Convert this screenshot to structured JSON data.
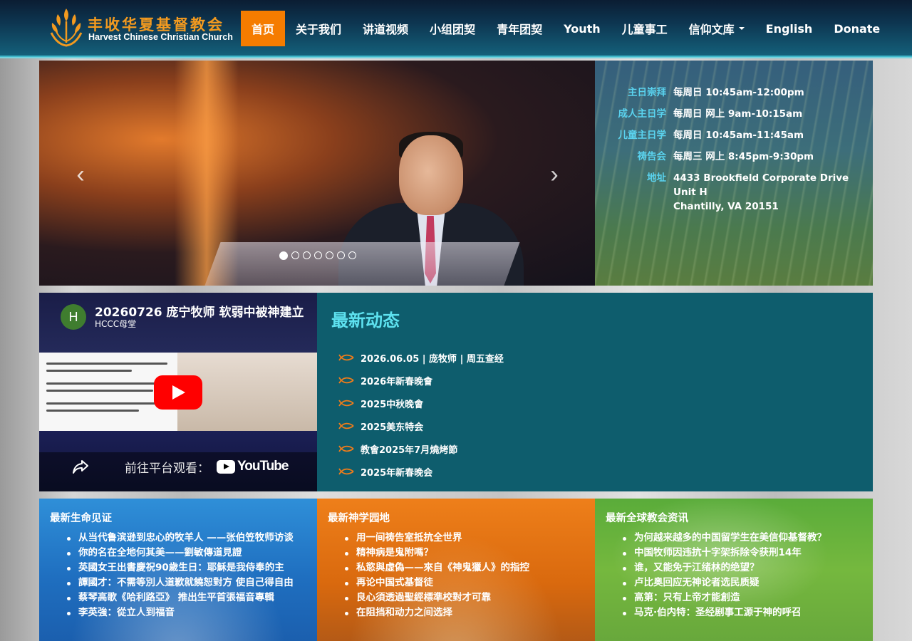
{
  "brand": {
    "name_cn": "丰收华夏基督教会",
    "name_en": "Harvest Chinese Christian Church",
    "accent_orange": "#f57c00",
    "nav_bg": "#0d3550"
  },
  "nav": {
    "items": [
      {
        "label": "首页",
        "active": true
      },
      {
        "label": "关于我们"
      },
      {
        "label": "讲道视频"
      },
      {
        "label": "小组团契"
      },
      {
        "label": "青年团契"
      },
      {
        "label": "Youth"
      },
      {
        "label": "儿童事工"
      },
      {
        "label": "信仰文库",
        "dropdown": true
      },
      {
        "label": "English"
      },
      {
        "label": "Donate"
      }
    ]
  },
  "carousel": {
    "prev_icon": "chevron-left-icon",
    "next_icon": "chevron-right-icon",
    "slide_count": 7,
    "active_index": 0
  },
  "schedule": [
    {
      "label": "主日崇拜",
      "value": "每周日 10:45am-12:00pm"
    },
    {
      "label": "成人主日学",
      "value": "每周日 网上 9am-10:15am"
    },
    {
      "label": "儿童主日学",
      "value": "每周日 10:45am-11:45am"
    },
    {
      "label": "祷告会",
      "value": "每周三 网上 8:45pm-9:30pm"
    },
    {
      "label": "地址",
      "value": "4433 Brookfield Corporate Drive",
      "value2": "Unit H",
      "value3": "Chantilly, VA 20151"
    }
  ],
  "video": {
    "avatar_letter": "H",
    "title": "20260726 庞宁牧师 软弱中被神建立",
    "channel": "HCCC母堂",
    "watch_on": "前往平台观看：",
    "platform": "YouTube"
  },
  "news": {
    "title": "最新动态",
    "items": [
      "2026.06.05 | 庞牧师 | 周五查经",
      "2026年新春晚會",
      "2025中秋晚會",
      "2025美东特会",
      "教會2025年7月燒烤節",
      "2025年新春晚会"
    ]
  },
  "panels": [
    {
      "title": "最新生命见证",
      "items": [
        "从当代鲁滨逊到忠心的牧羊人 ——张伯笠牧师访谈",
        "你的名在全地何其美——劉敏傳道見證",
        "英國女王出書慶祝90歲生日：耶穌是我侍奉的主",
        "譚國才：不需等別人道歉就饒恕對方 使自己得自由",
        "蔡琴高歌《哈利路亞》 推出生平首張福音專輯",
        "李英強：從立人到福音"
      ]
    },
    {
      "title": "最新神学园地",
      "items": [
        "用一间祷告室抵抗全世界",
        "精神病是鬼附嗎？",
        "私慾與虛偽——來自《神鬼獵人》的指控",
        "再论中国式基督徒",
        "良心須透過聖經標準校對才可靠",
        "在阻挡和动力之间选择"
      ]
    },
    {
      "title": "最新全球教会资讯",
      "items": [
        "为何越来越多的中国留学生在美信仰基督教？",
        "中国牧师因违抗十字架拆除令获刑14年",
        "谁，又能免于江绪林的绝望？",
        "卢比奥回应无神论者选民质疑",
        "高第：只有上帝才能創造",
        "马克·伯内特：圣经剧事工源于神的呼召"
      ]
    }
  ]
}
